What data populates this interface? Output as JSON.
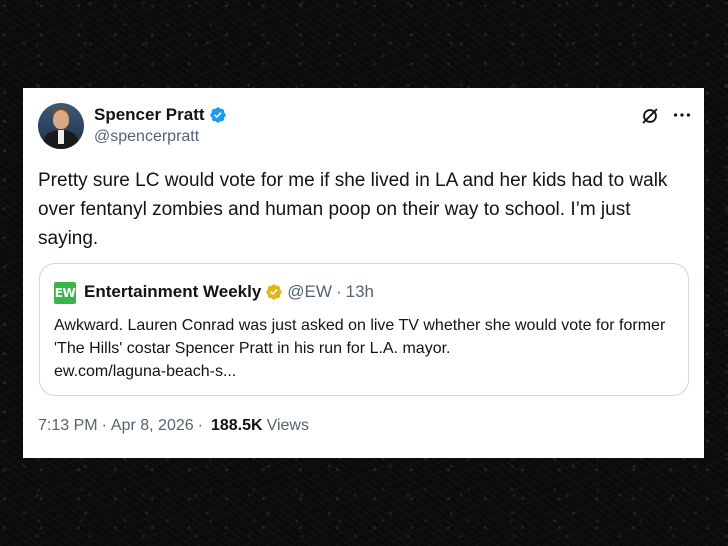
{
  "author": {
    "name": "Spencer Pratt",
    "handle": "@spencerpratt",
    "verified_color": "#1d9bf0"
  },
  "tweet": {
    "text": "Pretty sure LC would vote for me if she lived in LA and her kids had to walk over fentanyl zombies and human poop on their way to school. I’m just saying."
  },
  "quote": {
    "logo_text": "EW",
    "logo_color": "#3ab54a",
    "name": "Entertainment Weekly",
    "badge_color": "#e2b719",
    "handle": "@EW",
    "dot": "·",
    "time": "13h",
    "text": "Awkward. Lauren Conrad was just asked on live TV whether she would vote for former 'The Hills' costar Spencer Pratt in his run for L.A. mayor.",
    "link": "ew.com/laguna-beach-s..."
  },
  "footer": {
    "time": "7:13 PM",
    "sep1": "·",
    "date": "Apr 8, 2026",
    "sep2": "·",
    "views_count": "188.5K",
    "views_label": "Views"
  },
  "icons": {
    "grok": "grok-icon",
    "more": "more-icon"
  }
}
